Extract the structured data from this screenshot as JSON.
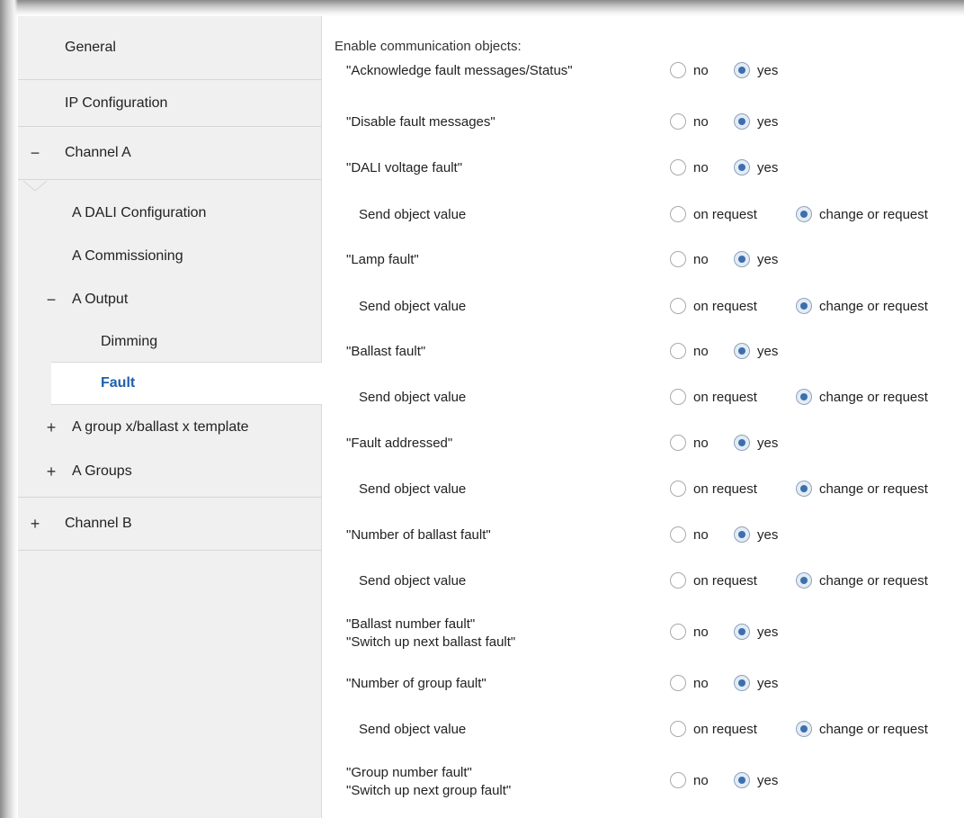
{
  "sidebar": {
    "items": [
      {
        "label": "General",
        "toggle": ""
      },
      {
        "label": "IP Configuration",
        "toggle": ""
      },
      {
        "label": "Channel A",
        "toggle": "−"
      },
      {
        "label": "A DALI Configuration",
        "toggle": ""
      },
      {
        "label": "A Commissioning",
        "toggle": ""
      },
      {
        "label": "A Output",
        "toggle": "−"
      },
      {
        "label": "Dimming",
        "toggle": ""
      },
      {
        "label": "Fault",
        "toggle": ""
      },
      {
        "label": "A group x/ballast x template",
        "toggle": "+"
      },
      {
        "label": "A Groups",
        "toggle": "+"
      },
      {
        "label": "Channel B",
        "toggle": "+"
      }
    ],
    "selected": "Fault"
  },
  "content": {
    "heading": "Enable communication objects:",
    "rows": [
      {
        "label": "\"Acknowledge fault messages/Status\"",
        "opt1": "no",
        "opt2": "yes",
        "selected": "yes"
      },
      {
        "label": "\"Disable fault messages\"",
        "opt1": "no",
        "opt2": "yes",
        "selected": "yes"
      },
      {
        "label": "\"DALI voltage fault\"",
        "opt1": "no",
        "opt2": "yes",
        "selected": "yes"
      },
      {
        "label": "Send object value",
        "opt1": "on request",
        "opt2": "change or request",
        "selected": "change or request"
      },
      {
        "label": "\"Lamp fault\"",
        "opt1": "no",
        "opt2": "yes",
        "selected": "yes"
      },
      {
        "label": "Send object value",
        "opt1": "on request",
        "opt2": "change or request",
        "selected": "change or request"
      },
      {
        "label": "\"Ballast fault\"",
        "opt1": "no",
        "opt2": "yes",
        "selected": "yes"
      },
      {
        "label": "Send object value",
        "opt1": "on request",
        "opt2": "change or request",
        "selected": "change or request"
      },
      {
        "label": "\"Fault addressed\"",
        "opt1": "no",
        "opt2": "yes",
        "selected": "yes"
      },
      {
        "label": "Send object value",
        "opt1": "on request",
        "opt2": "change or request",
        "selected": "change or request"
      },
      {
        "label": "\"Number of ballast fault\"",
        "opt1": "no",
        "opt2": "yes",
        "selected": "yes"
      },
      {
        "label": "Send object value",
        "opt1": "on request",
        "opt2": "change or request",
        "selected": "change or request"
      },
      {
        "label": "\"Ballast number fault\"",
        "label2": "\"Switch up next ballast fault\"",
        "opt1": "no",
        "opt2": "yes",
        "selected": "yes"
      },
      {
        "label": "\"Number of group fault\"",
        "opt1": "no",
        "opt2": "yes",
        "selected": "yes"
      },
      {
        "label": "Send object value",
        "opt1": "on request",
        "opt2": "change or request",
        "selected": "change or request"
      },
      {
        "label": "\"Group number fault\"",
        "label2": "\"Switch up next group fault\"",
        "opt1": "no",
        "opt2": "yes",
        "selected": "yes"
      }
    ]
  }
}
